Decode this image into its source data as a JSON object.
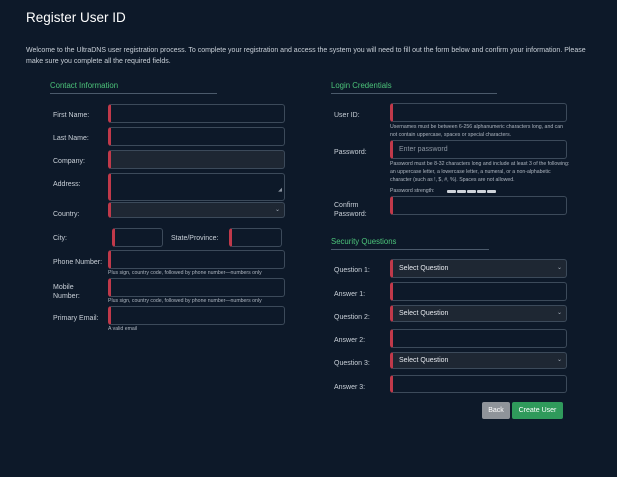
{
  "page": {
    "title": "Register User ID",
    "intro": "Welcome to the UltraDNS user registration process. To complete your registration and access the system you will need to fill out the form below and confirm your information. Please make sure you complete all the required fields."
  },
  "contact": {
    "heading": "Contact Information",
    "first_name_label": "First Name:",
    "last_name_label": "Last Name:",
    "company_label": "Company:",
    "address_label": "Address:",
    "country_label": "Country:",
    "country_value": "",
    "city_label": "City:",
    "state_label": "State/Province:",
    "phone_label": "Phone Number:",
    "phone_hint": "Plus sign, country code, followed by phone number—numbers only",
    "mobile_label": "Mobile Number:",
    "mobile_hint": "Plus sign, country code, followed by phone number—numbers only",
    "email_label": "Primary Email:",
    "email_hint": "A valid email"
  },
  "login": {
    "heading": "Login Credentials",
    "userid_label": "User ID:",
    "userid_hint": "Usernames must be between 6-256 alphanumeric characters long, and can not contain uppercase, spaces or special characters.",
    "password_label": "Password:",
    "password_placeholder": "Enter password",
    "password_hint": "Password must be 8-32 characters long and include at least 3 of the following: an uppercase letter, a lowercase letter, a numeral, or a non-alphabetic character (such as !, $, #, %). Spaces are not allowed.",
    "strength_label": "Password strength:",
    "strength_segments": 5,
    "confirm_label": "Confirm Password:"
  },
  "security": {
    "heading": "Security Questions",
    "q1_label": "Question 1:",
    "q1_value": "Select Question",
    "a1_label": "Answer 1:",
    "q2_label": "Question 2:",
    "q2_value": "Select Question",
    "a2_label": "Answer 2:",
    "q3_label": "Question 3:",
    "q3_value": "Select Question",
    "a3_label": "Answer 3:"
  },
  "actions": {
    "back": "Back",
    "create": "Create User"
  },
  "colors": {
    "background": "#0d1929",
    "accent_green": "#4cc47a",
    "required_red": "#c0394a",
    "button_green": "#2f9a5b",
    "button_gray": "#8f949a"
  }
}
